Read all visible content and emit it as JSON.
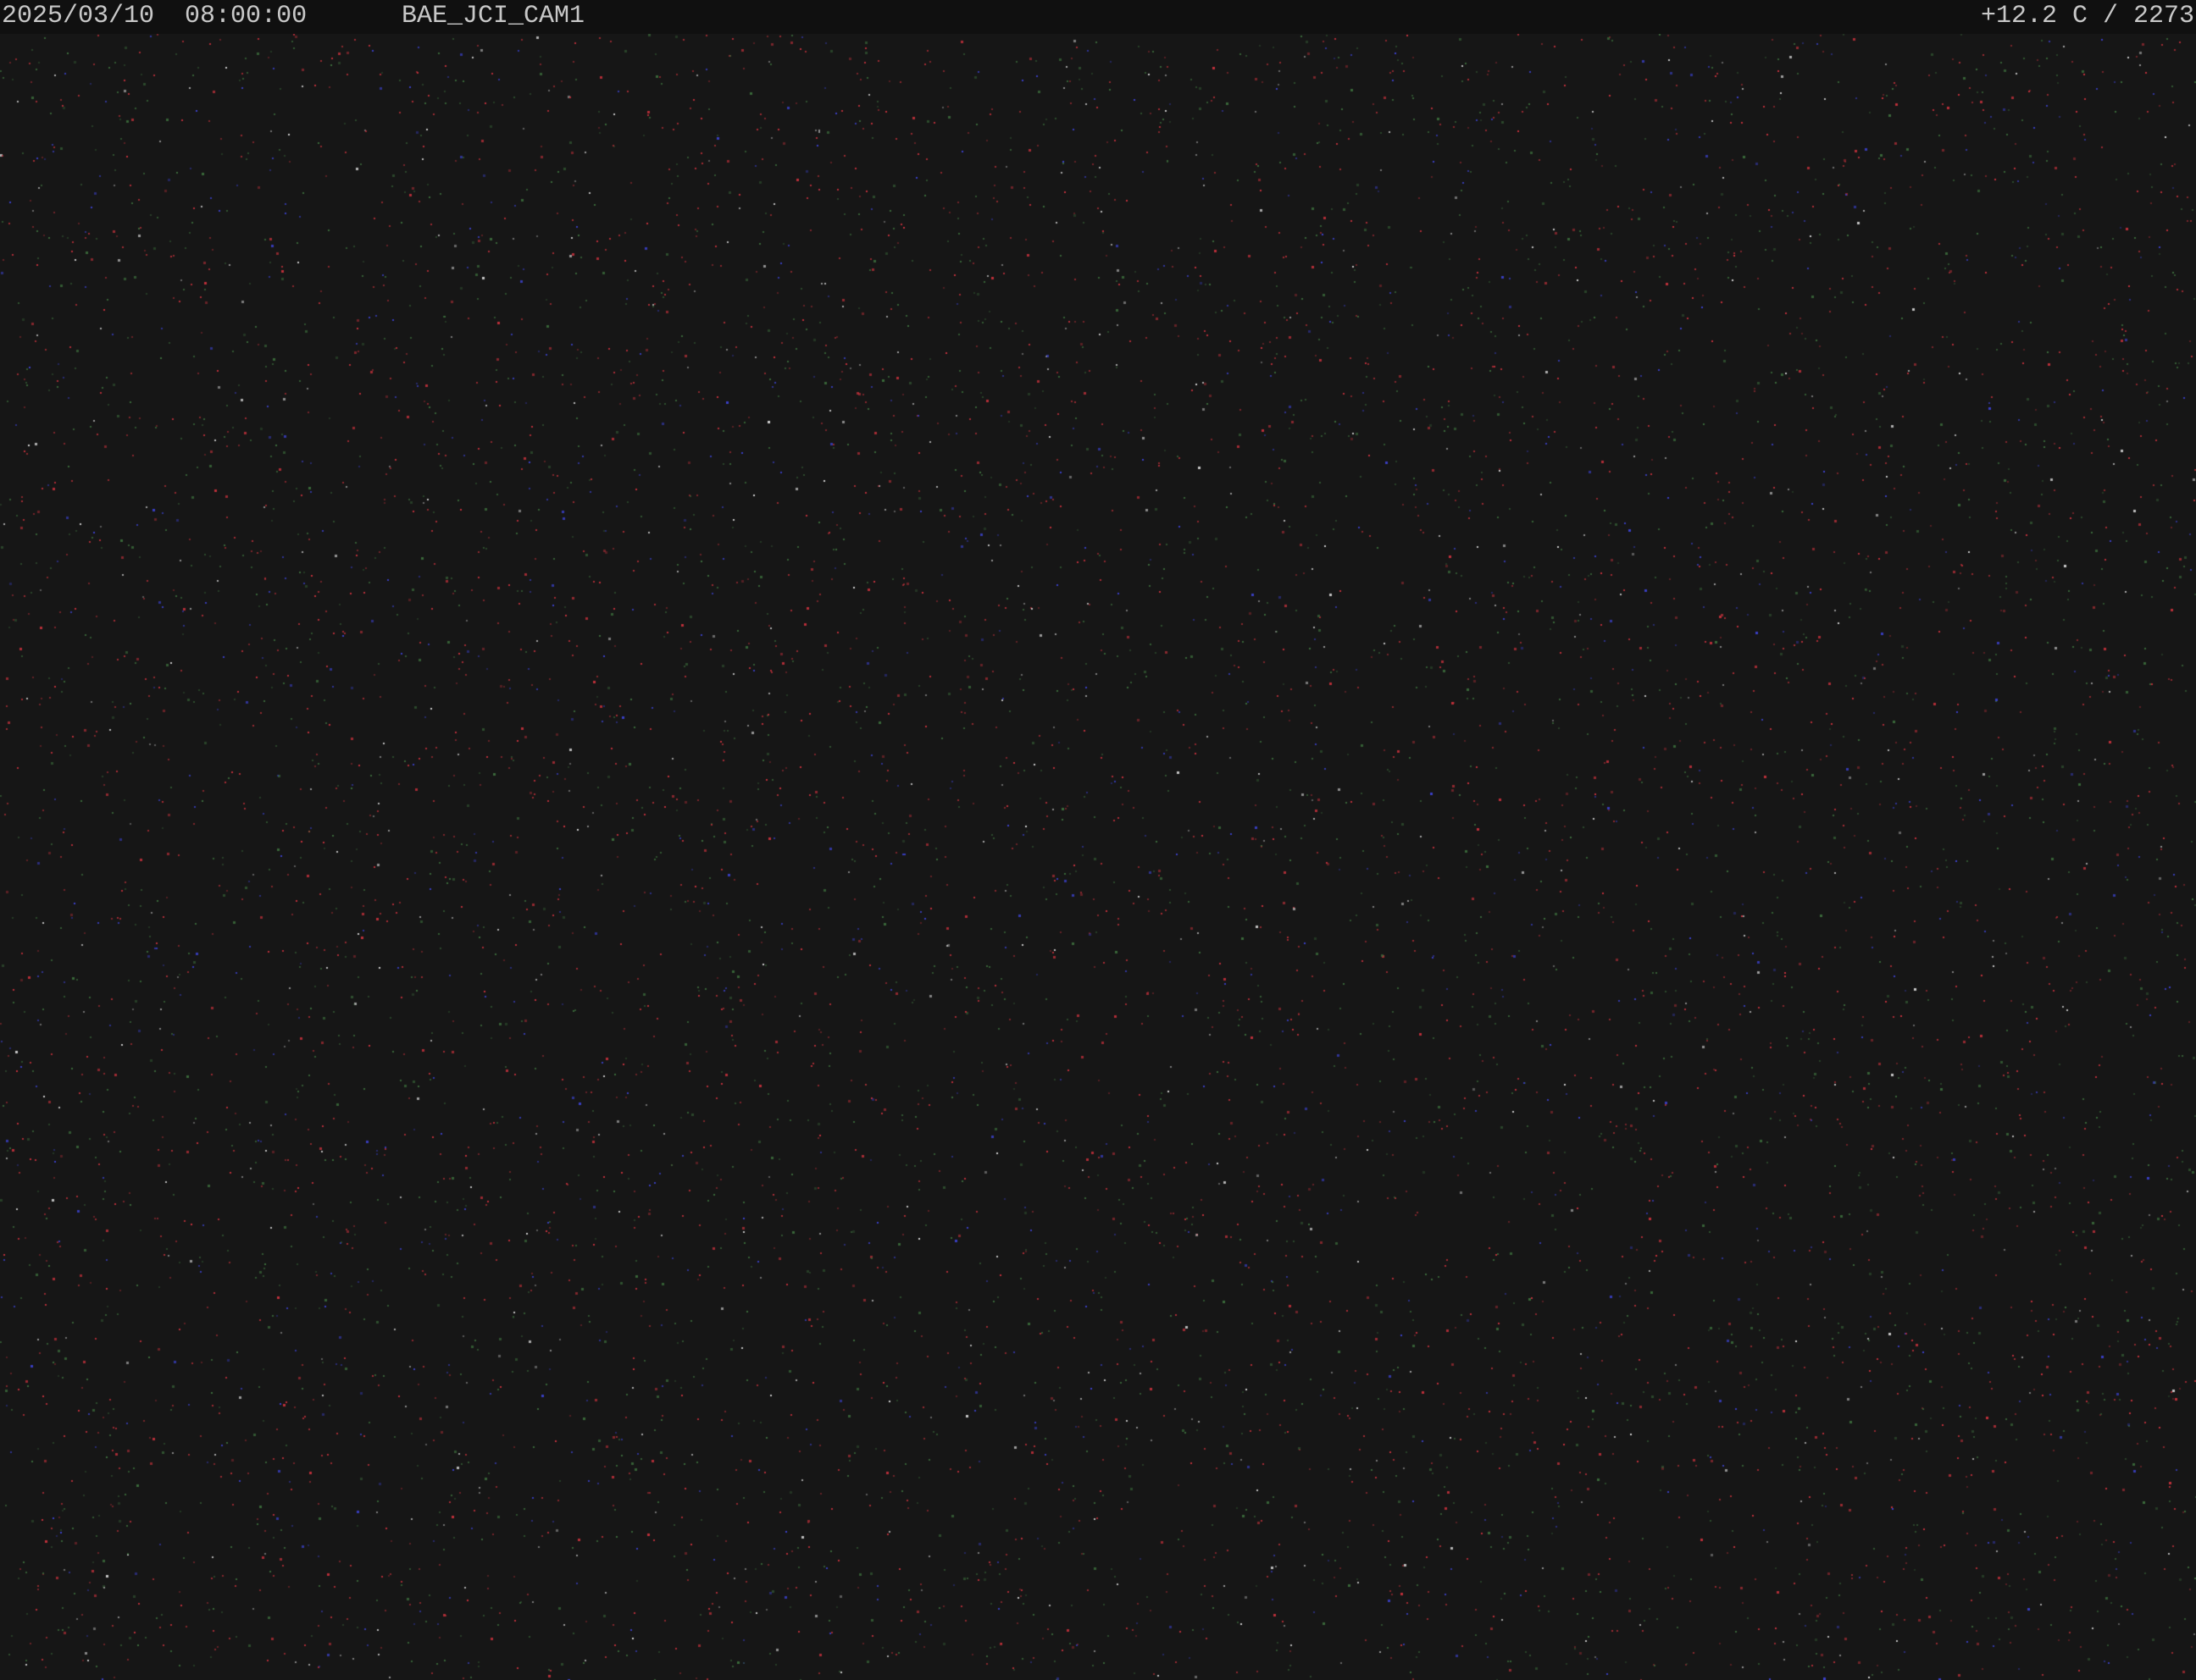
{
  "overlay": {
    "date": "2025/03/10",
    "time": "08:00:00",
    "camera_name": "BAE_JCI_CAM1",
    "status": "+12.2 C / 2273"
  },
  "colors": {
    "background": "#161616",
    "overlay_bar": "#101010",
    "overlay_text": "#c8c8c8",
    "noise_red": "#c0303a",
    "noise_green": "#3a6a3a",
    "noise_blue": "#3a40c8",
    "noise_white": "#d0d0d0"
  }
}
